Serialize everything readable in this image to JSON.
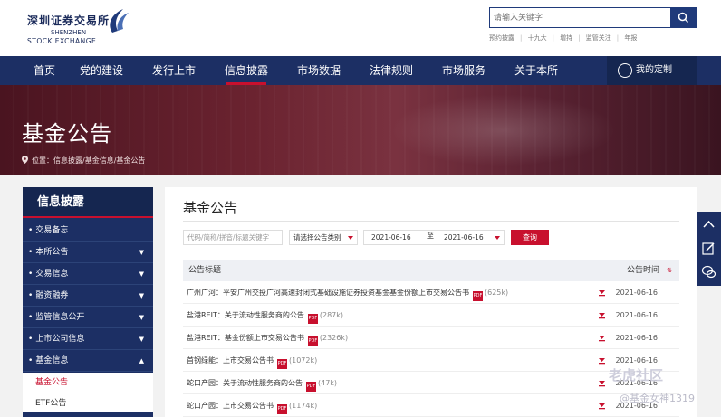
{
  "header": {
    "logo_cn": "深圳证券交易所",
    "logo_en1": "SHENZHEN",
    "logo_en2": "STOCK EXCHANGE",
    "search_placeholder": "请输入关键字",
    "quick_links": [
      "预约披露",
      "十九大",
      "增持",
      "监管关注",
      "年报"
    ]
  },
  "nav": {
    "items": [
      "首页",
      "党的建设",
      "发行上市",
      "信息披露",
      "市场数据",
      "法律规则",
      "市场服务",
      "关于本所"
    ],
    "active": "信息披露",
    "custom_label": "我的定制"
  },
  "banner": {
    "title": "基金公告",
    "breadcrumb": "位置：信息披露/基金信息/基金公告"
  },
  "sidebar": {
    "title": "信息披露",
    "items": [
      {
        "label": "交易备忘",
        "expand": ""
      },
      {
        "label": "本所公告",
        "expand": "▼"
      },
      {
        "label": "交易信息",
        "expand": "▼"
      },
      {
        "label": "融资融券",
        "expand": "▼"
      },
      {
        "label": "监管信息公开",
        "expand": "▼"
      },
      {
        "label": "上市公司信息",
        "expand": "▼"
      },
      {
        "label": "基金信息",
        "expand": "▲"
      }
    ],
    "sub_items": [
      "基金公告",
      "ETF公告"
    ]
  },
  "panel": {
    "title": "基金公告",
    "filters": {
      "code_placeholder": "代码/简称/拼音/标题关键字",
      "category": "请选择公告类别",
      "date_from": "2021-06-16",
      "to_label": "至",
      "date_to": "2021-06-16",
      "query_label": "查询"
    },
    "table": {
      "col_title": "公告标题",
      "col_time": "公告时间",
      "rows": [
        {
          "title": "广州广河：平安广州交投广河高速封闭式基础设施证券投资基金基金份额上市交易公告书",
          "size": "(625k)",
          "date": "2021-06-16"
        },
        {
          "title": "盐港REIT：关于流动性服务商的公告",
          "size": "(287k)",
          "date": "2021-06-16"
        },
        {
          "title": "盐港REIT：基金份额上市交易公告书",
          "size": "(2326k)",
          "date": "2021-06-16"
        },
        {
          "title": "首钢绿能：上市交易公告书",
          "size": "(1072k)",
          "date": "2021-06-16"
        },
        {
          "title": "蛇口产园：关于流动性服务商的公告",
          "size": "(47k)",
          "date": "2021-06-16"
        },
        {
          "title": "蛇口产园：上市交易公告书",
          "size": "(1174k)",
          "date": "2021-06-16"
        }
      ]
    }
  },
  "watermark": {
    "line1": "老虎社区",
    "line2": "@基金女神1319"
  },
  "colors": {
    "navy": "#1c2f64",
    "accent_red": "#c8102e"
  }
}
